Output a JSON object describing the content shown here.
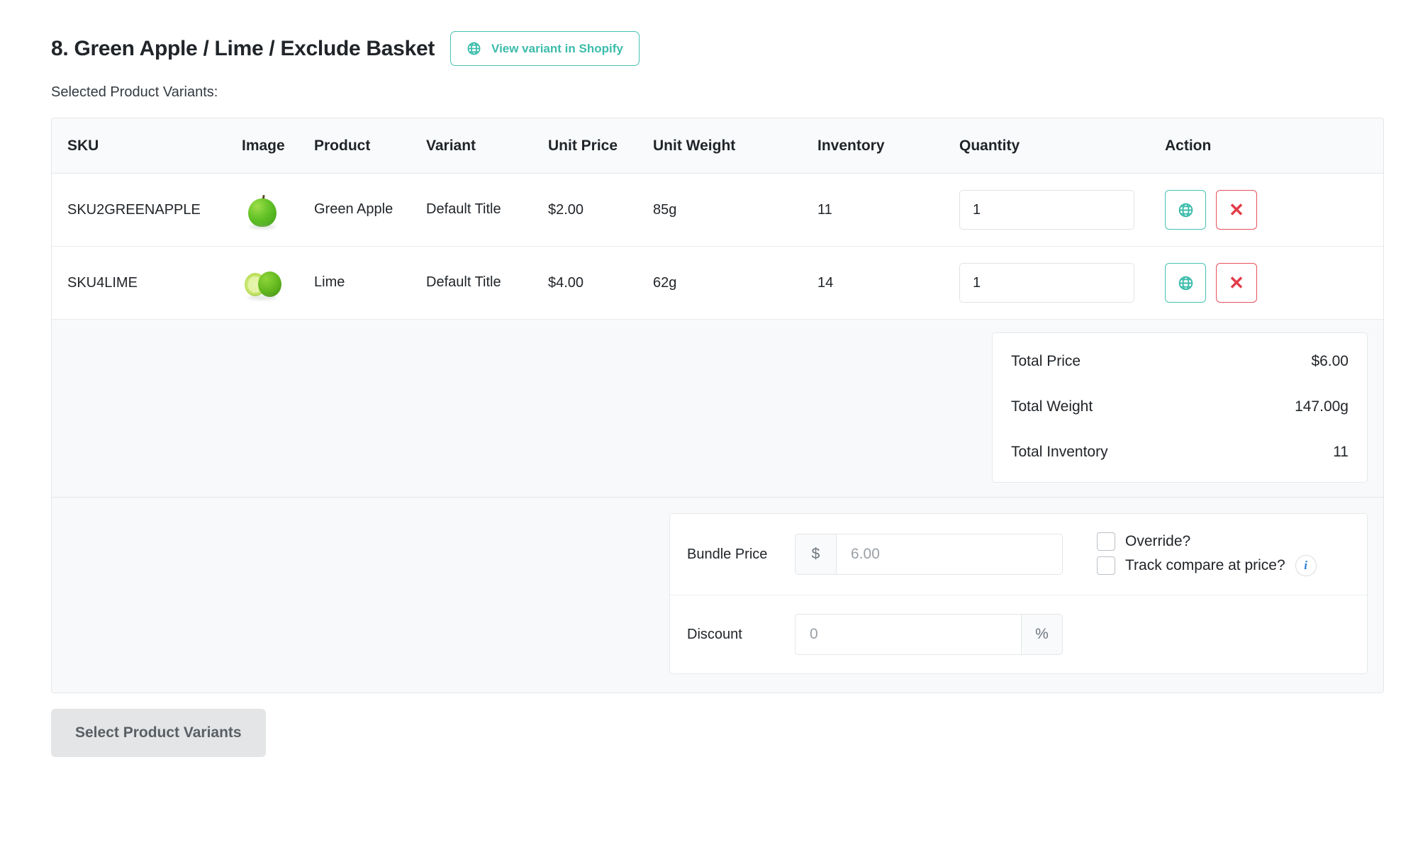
{
  "header": {
    "title": "8. Green Apple / Lime / Exclude Basket",
    "view_variant_button": "View variant in Shopify",
    "selected_label": "Selected Product Variants:"
  },
  "table": {
    "columns": [
      "SKU",
      "Image",
      "Product",
      "Variant",
      "Unit Price",
      "Unit Weight",
      "Inventory",
      "Quantity",
      "Action"
    ],
    "rows": [
      {
        "sku": "SKU2GREENAPPLE",
        "image": "green-apple-thumbnail",
        "product": "Green Apple",
        "variant": "Default Title",
        "unit_price": "$2.00",
        "unit_weight": "85g",
        "inventory": "11",
        "quantity": "1"
      },
      {
        "sku": "SKU4LIME",
        "image": "lime-thumbnail",
        "product": "Lime",
        "variant": "Default Title",
        "unit_price": "$4.00",
        "unit_weight": "62g",
        "inventory": "14",
        "quantity": "1"
      }
    ]
  },
  "summary": {
    "total_price_label": "Total Price",
    "total_price_value": "$6.00",
    "total_weight_label": "Total Weight",
    "total_weight_value": "147.00g",
    "total_inventory_label": "Total Inventory",
    "total_inventory_value": "11"
  },
  "pricing": {
    "bundle_price_label": "Bundle Price",
    "bundle_currency_addon": "$",
    "bundle_price_value": "",
    "bundle_price_placeholder": "6.00",
    "discount_label": "Discount",
    "discount_value": "",
    "discount_placeholder": "0",
    "discount_percent_addon": "%",
    "override_label": "Override?",
    "override_checked": false,
    "track_compare_label": "Track compare at price?",
    "track_compare_checked": false,
    "info_glyph": "i"
  },
  "footer": {
    "select_variants_button": "Select Product Variants"
  },
  "colors": {
    "teal": "#45c2b1",
    "red": "#e8505b",
    "info_blue": "#2a7fd4",
    "header_bg": "#f9fafb",
    "summary_bg": "#f8f9fa",
    "border": "#e3e6e8"
  },
  "icons": {
    "globe": "globe-icon",
    "close": "close-x-icon",
    "info": "info-icon"
  }
}
